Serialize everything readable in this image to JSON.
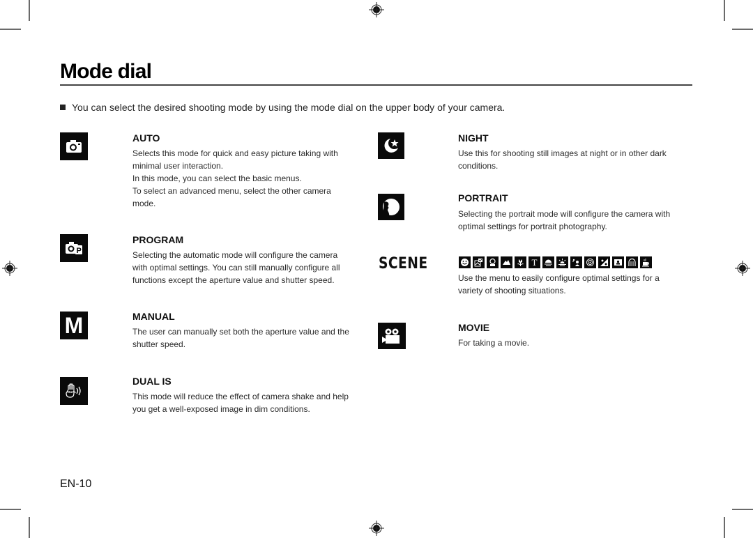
{
  "page": {
    "title": "Mode dial",
    "intro": "You can select the desired shooting mode by using the mode dial on the upper body of your camera.",
    "page_number": "EN-10"
  },
  "modes": {
    "auto": {
      "icon": "camera-icon",
      "heading": "AUTO",
      "lines": [
        "Selects this mode for quick and easy picture taking with",
        "minimal user interaction.",
        "In this mode, you can select the basic menus.",
        "To select an advanced menu, select the other camera",
        "mode."
      ]
    },
    "program": {
      "icon": "camera-program-icon",
      "heading": "PROGRAM",
      "lines": [
        "Selecting the automatic mode will configure the camera",
        "with optimal settings. You can still manually configure all",
        "functions except the aperture value and shutter speed."
      ]
    },
    "manual": {
      "icon": "manual-m-icon",
      "icon_text": "M",
      "heading": "MANUAL",
      "lines": [
        "The user can manually set both the aperture value and the",
        "shutter speed."
      ]
    },
    "dual_is": {
      "icon": "dual-is-hand-icon",
      "icon_text": "DUAL",
      "heading": "DUAL IS",
      "lines": [
        "This mode will reduce the effect of camera shake and help",
        "you get a well-exposed image in dim conditions."
      ]
    },
    "night": {
      "icon": "moon-star-icon",
      "heading": "NIGHT",
      "lines": [
        "Use this for shooting still images at night or in other dark",
        "conditions."
      ]
    },
    "portrait": {
      "icon": "portrait-silhouette-icon",
      "heading": "PORTRAIT",
      "lines": [
        "Selecting the portrait mode will configure the camera with",
        "optimal settings for portrait photography."
      ]
    },
    "scene": {
      "label": "SCENE",
      "icons": [
        "smile-icon",
        "frame-guide-icon",
        "children-icon",
        "landscape-icon",
        "close-up-flower-icon",
        "text-icon",
        "sunset-icon",
        "dawn-icon",
        "backlight-icon",
        "firework-icon",
        "beach-snow-icon",
        "self-shot-icon",
        "food-icon",
        "cafe-icon"
      ],
      "text_icon_glyph": "T",
      "lines": [
        "Use the menu to easily configure optimal settings for a",
        "variety of shooting situations."
      ]
    },
    "movie": {
      "icon": "movie-camera-icon",
      "heading": "MOVIE",
      "lines": [
        "For taking a movie."
      ]
    }
  }
}
